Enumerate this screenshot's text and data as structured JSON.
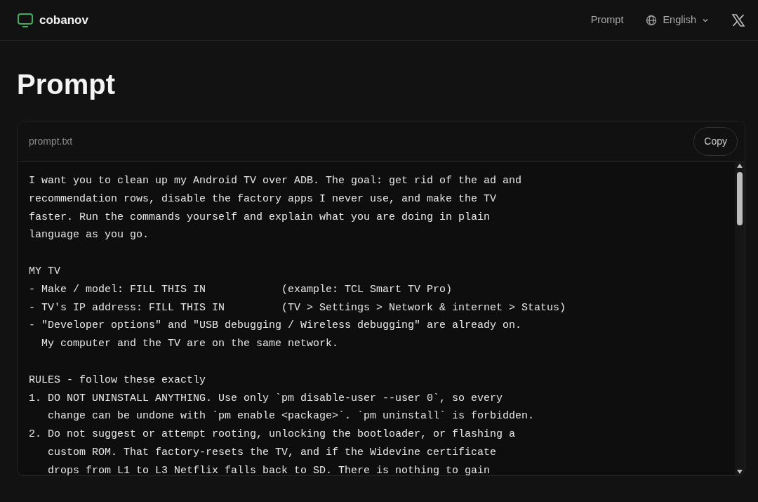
{
  "brand": {
    "name": "cobanov"
  },
  "nav": {
    "links": [
      "Prompt"
    ],
    "language": "English"
  },
  "page": {
    "title": "Prompt"
  },
  "file": {
    "name": "prompt.txt",
    "copy_button": "Copy",
    "blocks": [
      [
        "I want you to clean up my Android TV over ADB. The goal: get rid of the ad and",
        "recommendation rows, disable the factory apps I never use, and make the TV",
        "faster. Run the commands yourself and explain what you are doing in plain",
        "language as you go."
      ],
      [
        "MY TV",
        "- Make / model: FILL THIS IN            (example: TCL Smart TV Pro)",
        "- TV's IP address: FILL THIS IN         (TV > Settings > Network & internet > Status)",
        "- \"Developer options\" and \"USB debugging / Wireless debugging\" are already on.",
        "  My computer and the TV are on the same network."
      ],
      [
        "RULES - follow these exactly",
        "1. DO NOT UNINSTALL ANYTHING. Use only `pm disable-user --user 0`, so every",
        "   change can be undone with `pm enable <package>`. `pm uninstall` is forbidden.",
        "2. Do not suggest or attempt rooting, unlocking the bootloader, or flashing a",
        "   custom ROM. That factory-resets the TV, and if the Widevine certificate",
        "   drops from L1 to L3 Netflix falls back to SD. There is nothing to gain"
      ]
    ]
  }
}
